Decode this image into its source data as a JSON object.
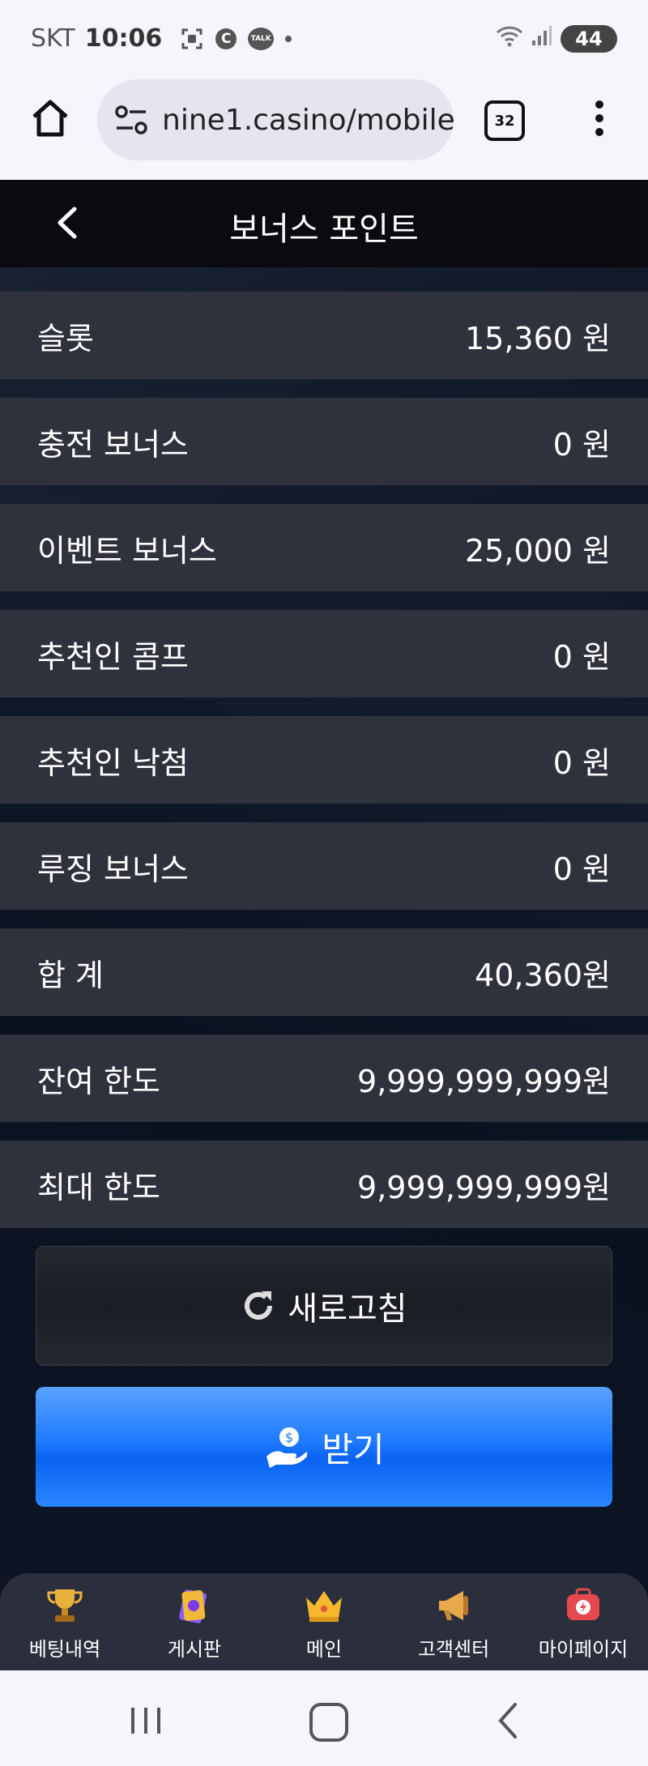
{
  "status_bar": {
    "carrier": "SKT",
    "time": "10:06",
    "c_icon_text": "C",
    "talk_icon_text": "TALK",
    "battery": "44"
  },
  "browser": {
    "url": "nine1.casino/mobile",
    "tab_count": "32"
  },
  "header": {
    "title": "보너스 포인트"
  },
  "rows": [
    {
      "label": "슬롯",
      "value": "15,360 원"
    },
    {
      "label": "충전 보너스",
      "value": "0 원"
    },
    {
      "label": "이벤트 보너스",
      "value": "25,000 원"
    },
    {
      "label": "추천인 콤프",
      "value": "0 원"
    },
    {
      "label": "추천인 낙첨",
      "value": "0 원"
    },
    {
      "label": "루징 보너스",
      "value": "0 원"
    },
    {
      "label": "합 계",
      "value": "40,360원"
    },
    {
      "label": "잔여 한도",
      "value": "9,999,999,999원"
    },
    {
      "label": "최대 한도",
      "value": "9,999,999,999원"
    }
  ],
  "buttons": {
    "refresh": "새로고침",
    "receive": "받기"
  },
  "bottom_nav": [
    {
      "label": "베팅내역",
      "icon": "trophy-icon"
    },
    {
      "label": "게시판",
      "icon": "card-icon"
    },
    {
      "label": "메인",
      "icon": "crown-icon"
    },
    {
      "label": "고객센터",
      "icon": "megaphone-icon"
    },
    {
      "label": "마이페이지",
      "icon": "mypage-box-icon"
    }
  ],
  "colors": {
    "row_bg": "#2f323d",
    "header_bg": "#0a0b10",
    "receive_blue": "#1f7bff",
    "nav_bg": "#2b2e3c"
  }
}
